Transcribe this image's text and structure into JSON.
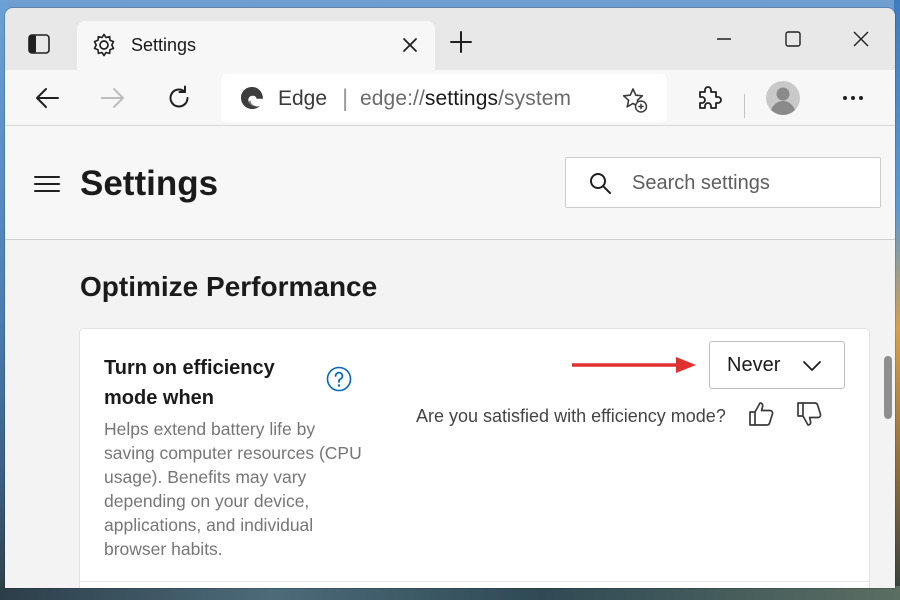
{
  "browser": {
    "tab": {
      "title": "Settings"
    },
    "address_bar": {
      "site_name": "Edge",
      "separator": "|",
      "url_prefix": "edge://",
      "url_host": "settings",
      "url_path": "/system"
    }
  },
  "settings": {
    "title": "Settings",
    "search": {
      "placeholder": "Search settings"
    },
    "section_title": "Optimize Performance",
    "efficiency_card": {
      "title": "Turn on efficiency mode when",
      "description": "Helps extend battery life by saving computer resources (CPU usage). Benefits may vary depending on your device, applications, and individual browser habits.",
      "dropdown_value": "Never",
      "feedback_prompt": "Are you satisfied with efficiency mode?"
    }
  },
  "colors": {
    "accent": "#0067c0",
    "annotation_arrow": "#e03131"
  },
  "icons": [
    "sidebar-toggle-icon",
    "gear-icon",
    "close-icon",
    "plus-icon",
    "minimize-icon",
    "maximize-icon",
    "window-close-icon",
    "back-arrow-icon",
    "forward-arrow-icon",
    "refresh-icon",
    "edge-logo-icon",
    "favorite-star-add-icon",
    "extensions-puzzle-icon",
    "profile-avatar-icon",
    "more-dots-icon",
    "hamburger-menu-icon",
    "search-icon",
    "help-circle-icon",
    "chevron-down-icon",
    "thumbs-up-icon",
    "thumbs-down-icon",
    "red-arrow-icon"
  ]
}
